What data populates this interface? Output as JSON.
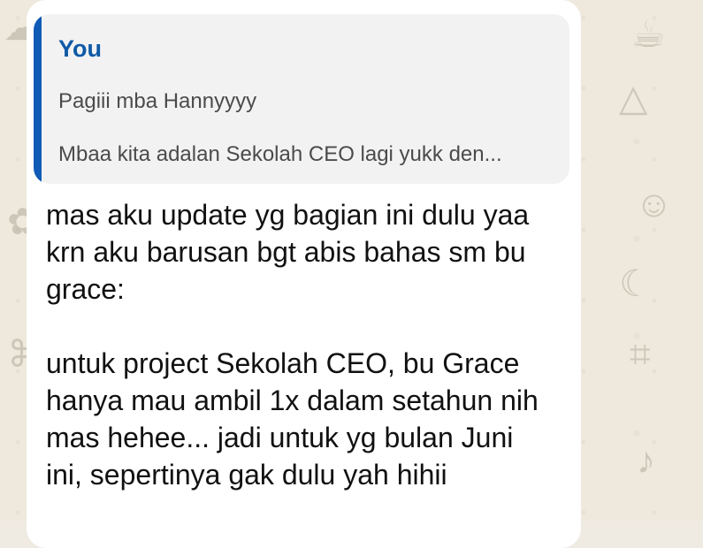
{
  "quoted_message": {
    "author": "You",
    "lines": [
      "Pagiii mba Hannyyyy",
      "Mbaa kita adalan Sekolah CEO lagi yukk den..."
    ]
  },
  "message": {
    "lines": [
      "mas aku update yg bagian ini dulu yaa",
      "krn aku barusan bgt abis bahas sm bu",
      "grace:",
      "",
      "untuk project Sekolah CEO, bu Grace",
      "hanya mau ambil 1x dalam setahun nih",
      "mas hehee... jadi untuk yg bulan Juni",
      "ini, sepertinya gak dulu yah hihii"
    ]
  },
  "colors": {
    "quote_accent": "#0f5bb5",
    "bubble_bg": "#ffffff",
    "quote_bg": "#f2f2f3",
    "wallpaper": "#efe9dd"
  },
  "icons": [
    "wallpaper-doodle-icon"
  ]
}
